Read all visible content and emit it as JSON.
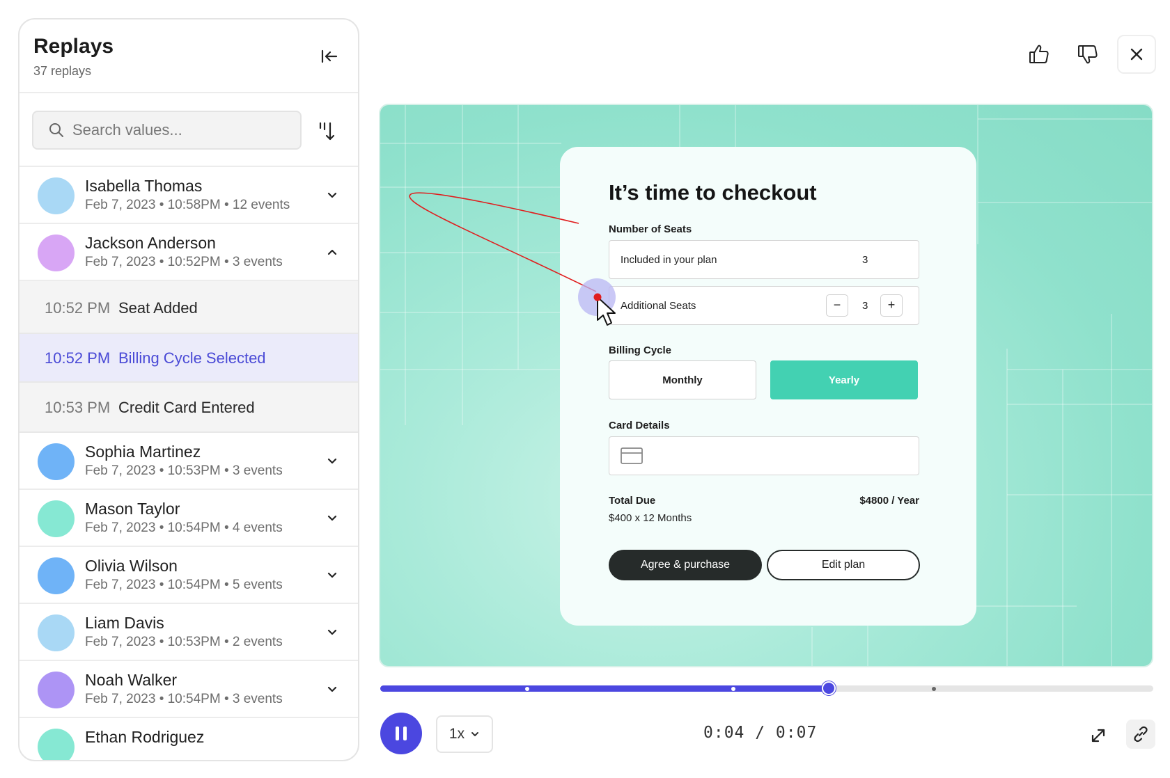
{
  "sidebar": {
    "title": "Replays",
    "subtitle": "37 replays",
    "search_placeholder": "Search values...",
    "users": [
      {
        "name": "Isabella Thomas",
        "meta": "Feb 7, 2023 • 10:58PM • 12 events",
        "avatar_color": "#a9d8f5",
        "expanded": false
      },
      {
        "name": "Jackson Anderson",
        "meta": "Feb 7, 2023 • 10:52PM • 3 events",
        "avatar_color": "#d8a6f5",
        "expanded": true
      },
      {
        "name": "Sophia Martinez",
        "meta": "Feb 7, 2023 • 10:53PM • 3 events",
        "avatar_color": "#6fb3f7",
        "expanded": false
      },
      {
        "name": "Mason Taylor",
        "meta": "Feb 7, 2023 • 10:54PM • 4 events",
        "avatar_color": "#86e8d3",
        "expanded": false
      },
      {
        "name": "Olivia Wilson",
        "meta": "Feb 7, 2023 • 10:54PM • 5 events",
        "avatar_color": "#6fb3f7",
        "expanded": false
      },
      {
        "name": "Liam Davis",
        "meta": "Feb 7, 2023 • 10:53PM • 2 events",
        "avatar_color": "#a9d8f5",
        "expanded": false
      },
      {
        "name": "Noah Walker",
        "meta": "Feb 7, 2023 • 10:54PM • 3 events",
        "avatar_color": "#ad94f5",
        "expanded": false
      },
      {
        "name": "Ethan Rodriguez",
        "meta": "",
        "avatar_color": "#86e8d3",
        "expanded": false
      }
    ],
    "events": [
      {
        "time": "10:52 PM",
        "name": "Seat Added",
        "active": false
      },
      {
        "time": "10:52 PM",
        "name": "Billing Cycle Selected",
        "active": true
      },
      {
        "time": "10:53 PM",
        "name": "Credit Card Entered",
        "active": false
      }
    ]
  },
  "checkout": {
    "title": "It’s time to checkout",
    "seats_label": "Number of Seats",
    "included_label": "Included in your plan",
    "included_value": "3",
    "additional_label": "Additional Seats",
    "additional_value": "3",
    "minus": "−",
    "plus": "+",
    "billing_label": "Billing Cycle",
    "monthly": "Monthly",
    "yearly": "Yearly",
    "card_label": "Card Details",
    "total_label": "Total Due",
    "total_value": "$4800 / Year",
    "total_sub": "$400 x 12 Months",
    "agree": "Agree & purchase",
    "edit": "Edit plan"
  },
  "player": {
    "progress": 0.58,
    "markers": [
      0.19,
      0.457,
      0.716
    ],
    "speed": "1x",
    "time": "0:04 / 0:07",
    "accent": "#4b47e0"
  },
  "icons": [
    "collapse-icon",
    "search-icon",
    "sort-icon",
    "chevron-down-icon",
    "chevron-up-icon",
    "thumbs-up-icon",
    "thumbs-down-icon",
    "close-icon",
    "card-icon",
    "cursor-icon",
    "pause-icon",
    "expand-icon",
    "link-icon"
  ]
}
